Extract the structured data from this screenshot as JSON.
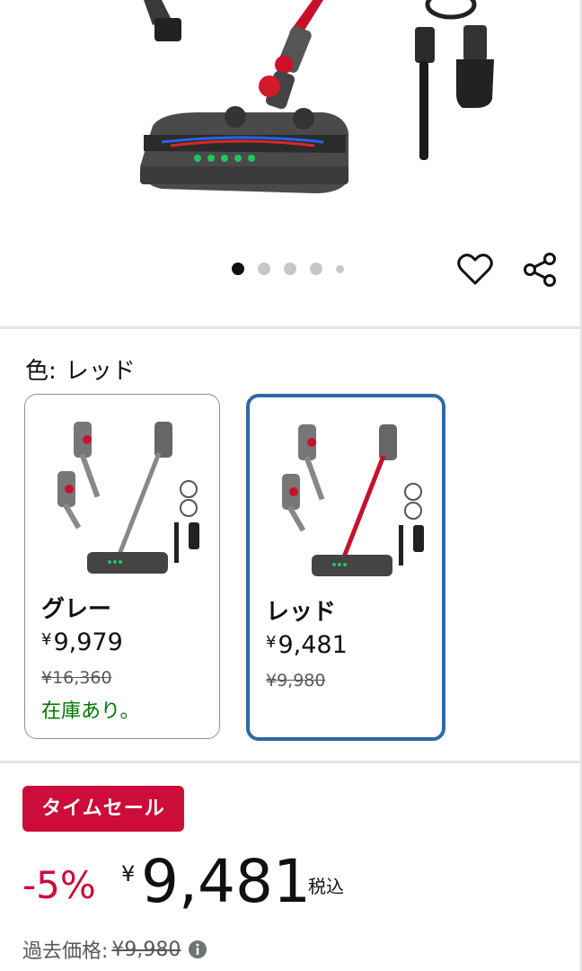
{
  "hero": {
    "carousel_total": 5,
    "carousel_active": 1
  },
  "color": {
    "label": "色:",
    "selected": "レッド"
  },
  "swatches": [
    {
      "name": "グレー",
      "yen": "¥",
      "price": "9,979",
      "old_price": "¥16,360",
      "stock": "在庫あり。"
    },
    {
      "name": "レッド",
      "yen": "¥",
      "price": "9,481",
      "old_price": "¥9,980"
    }
  ],
  "deal": {
    "badge": "タイムセール",
    "discount": "-5%",
    "yen": "¥",
    "price": "9,481",
    "tax": "税込",
    "past_label": "過去価格:",
    "past_price": "¥9,980"
  },
  "colors": {
    "deal_red": "#cc0c39",
    "selected_border": "#2d69a4",
    "stock_green": "#007600"
  }
}
